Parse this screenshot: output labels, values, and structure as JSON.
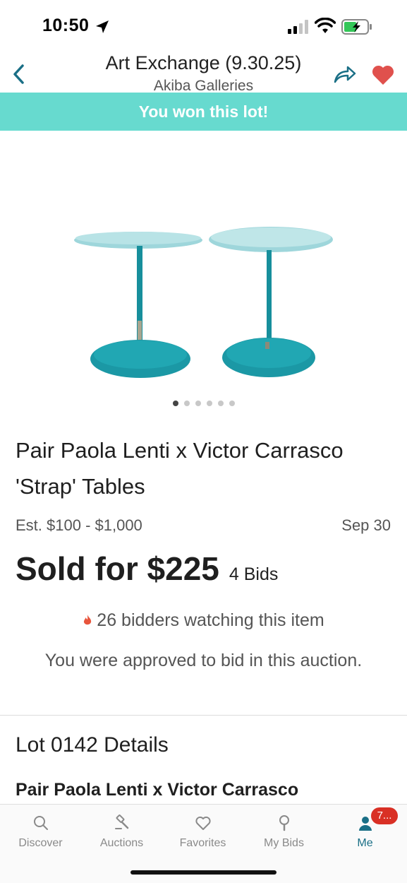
{
  "status_bar": {
    "time": "10:50"
  },
  "header": {
    "title": "Art Exchange (9.30.25)",
    "subtitle": "Akiba Galleries"
  },
  "banner": {
    "text": "You won this lot!",
    "color": "#67dacf"
  },
  "gallery": {
    "image_count": 6,
    "active_index": 0
  },
  "lot": {
    "title": "Pair Paola Lenti x Victor Carrasco 'Strap' Tables",
    "estimate": "Est. $100 - $1,000",
    "date": "Sep 30",
    "sold_price": "Sold for $225",
    "bids": "4 Bids",
    "watchers": "26 bidders watching this item",
    "approval": "You were approved to bid in this auction."
  },
  "details": {
    "heading": "Lot 0142 Details",
    "title": "Pair Paola Lenti x Victor Carrasco"
  },
  "tabs": [
    {
      "label": "Discover",
      "icon": "search-icon"
    },
    {
      "label": "Auctions",
      "icon": "gavel-icon"
    },
    {
      "label": "Favorites",
      "icon": "heart-outline-icon"
    },
    {
      "label": "My Bids",
      "icon": "paddle-icon"
    },
    {
      "label": "Me",
      "icon": "person-icon",
      "badge": "7...",
      "active": true
    }
  ],
  "colors": {
    "accent": "#1a6f86",
    "banner": "#67dacf",
    "favorite": "#e0514d",
    "badge": "#d93025"
  }
}
